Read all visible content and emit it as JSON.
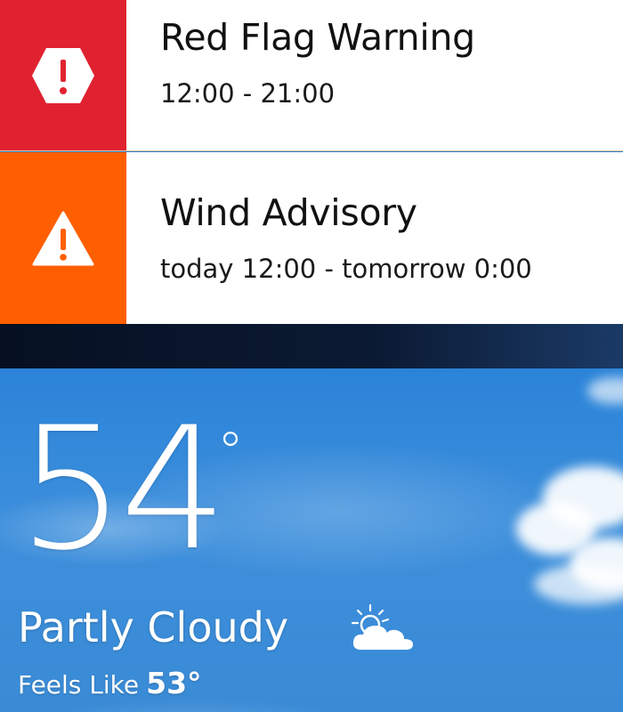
{
  "alerts": [
    {
      "title": "Red Flag Warning",
      "time": "12:00 - 21:00",
      "icon": "hexagon-exclamation-icon",
      "color": "#e02230"
    },
    {
      "title": "Wind Advisory",
      "time": "today 12:00 - tomorrow 0:00",
      "icon": "triangle-warning-icon",
      "color": "#ff5f00"
    }
  ],
  "current": {
    "temperature": "54",
    "degree_symbol": "°",
    "condition": "Partly Cloudy",
    "condition_icon": "partly-cloudy-icon",
    "feels_like_label": "Feels Like",
    "feels_like_value": "53°"
  }
}
